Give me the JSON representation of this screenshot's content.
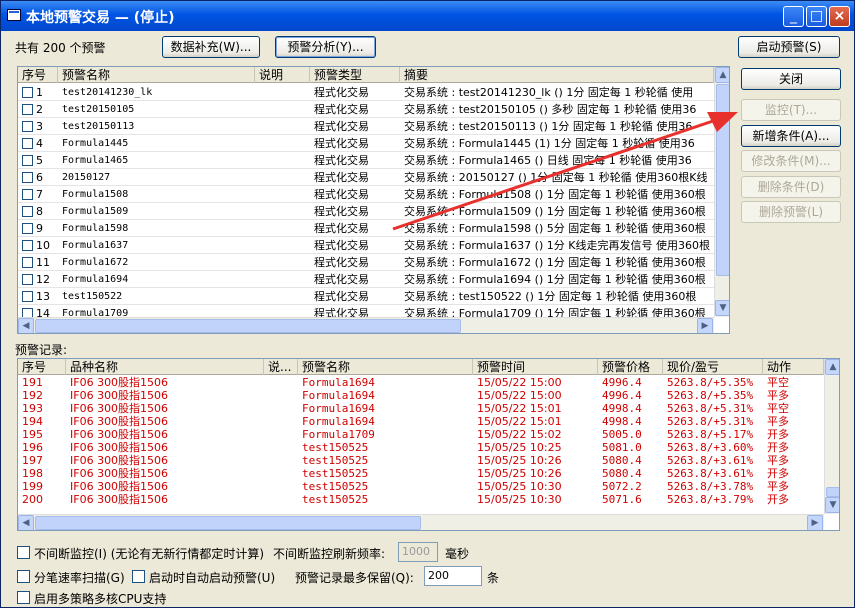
{
  "window": {
    "title": "本地预警交易 — (停止)"
  },
  "top": {
    "total_label": "共有 200 个预警",
    "btn_supplement": "数据补充(W)...",
    "btn_analysis": "预警分析(Y)...",
    "btn_start": "启动预警(S)"
  },
  "side": {
    "close": "关闭",
    "monitor": "监控(T)...",
    "add_cond": "新增条件(A)...",
    "edit_cond": "修改条件(M)...",
    "del_cond": "删除条件(D)",
    "del_alert": "删除预警(L)"
  },
  "alerts": {
    "headers": [
      "序号",
      "预警名称",
      "说明",
      "预警类型",
      "摘要"
    ],
    "rows": [
      [
        "1",
        "test20141230_lk",
        "",
        "程式化交易",
        "交易系统 : test20141230_lk () 1分 固定每 1 秒轮循 使用"
      ],
      [
        "2",
        "test20150105",
        "",
        "程式化交易",
        "交易系统 : test20150105 () 多秒 固定每 1 秒轮循 使用36"
      ],
      [
        "3",
        "test20150113",
        "",
        "程式化交易",
        "交易系统 : test20150113 () 1分 固定每 1 秒轮循 使用36"
      ],
      [
        "4",
        "Formula1445",
        "",
        "程式化交易",
        "交易系统 : Formula1445 (1) 1分 固定每 1 秒轮循 使用36"
      ],
      [
        "5",
        "Formula1465",
        "",
        "程式化交易",
        "交易系统 : Formula1465 () 日线 固定每 1 秒轮循 使用36"
      ],
      [
        "6",
        "20150127",
        "",
        "程式化交易",
        "交易系统 : 20150127 () 1分 固定每 1 秒轮循 使用360根K线"
      ],
      [
        "7",
        "Formula1508",
        "",
        "程式化交易",
        "交易系统 : Formula1508 () 1分 固定每 1 秒轮循 使用360根"
      ],
      [
        "8",
        "Formula1509",
        "",
        "程式化交易",
        "交易系统 : Formula1509 () 1分 固定每 1 秒轮循 使用360根"
      ],
      [
        "9",
        "Formula1598",
        "",
        "程式化交易",
        "交易系统 : Formula1598 () 5分 固定每 1 秒轮循 使用360根"
      ],
      [
        "10",
        "Formula1637",
        "",
        "程式化交易",
        "交易系统 : Formula1637 () 1分 K线走完再发信号 使用360根"
      ],
      [
        "11",
        "Formula1672",
        "",
        "程式化交易",
        "交易系统 : Formula1672 () 1分 固定每 1 秒轮循 使用360根"
      ],
      [
        "12",
        "Formula1694",
        "",
        "程式化交易",
        "交易系统 : Formula1694 () 1分 固定每 1 秒轮循 使用360根"
      ],
      [
        "13",
        "test150522",
        "",
        "程式化交易",
        "交易系统 : test150522 () 1分 固定每 1 秒轮循 使用360根"
      ],
      [
        "14",
        "Formula1709",
        "",
        "程式化交易",
        "交易系统 : Formula1709 () 1分 固定每 1 秒轮循 使用360根"
      ]
    ]
  },
  "records": {
    "section_label": "预警记录:",
    "headers": [
      "序号",
      "品种名称",
      "说...",
      "预警名称",
      "预警时间",
      "预警价格",
      "现价/盈亏",
      "动作"
    ],
    "rows": [
      [
        "191",
        "IF06 300股指1506",
        "",
        "Formula1694",
        "15/05/22 15:00",
        "4996.4",
        "5263.8/+5.35%",
        "平空"
      ],
      [
        "192",
        "IF06 300股指1506",
        "",
        "Formula1694",
        "15/05/22 15:00",
        "4996.4",
        "5263.8/+5.35%",
        "平多"
      ],
      [
        "193",
        "IF06 300股指1506",
        "",
        "Formula1694",
        "15/05/22 15:01",
        "4998.4",
        "5263.8/+5.31%",
        "平空"
      ],
      [
        "194",
        "IF06 300股指1506",
        "",
        "Formula1694",
        "15/05/22 15:01",
        "4998.4",
        "5263.8/+5.31%",
        "平多"
      ],
      [
        "195",
        "IF06 300股指1506",
        "",
        "Formula1709",
        "15/05/22 15:02",
        "5005.0",
        "5263.8/+5.17%",
        "开多"
      ],
      [
        "196",
        "IF06 300股指1506",
        "",
        "test150525",
        "15/05/25 10:25",
        "5081.0",
        "5263.8/+3.60%",
        "开多"
      ],
      [
        "197",
        "IF06 300股指1506",
        "",
        "test150525",
        "15/05/25 10:26",
        "5080.4",
        "5263.8/+3.61%",
        "平多"
      ],
      [
        "198",
        "IF06 300股指1506",
        "",
        "test150525",
        "15/05/25 10:26",
        "5080.4",
        "5263.8/+3.61%",
        "开多"
      ],
      [
        "199",
        "IF06 300股指1506",
        "",
        "test150525",
        "15/05/25 10:30",
        "5072.2",
        "5263.8/+3.78%",
        "平多"
      ],
      [
        "200",
        "IF06 300股指1506",
        "",
        "test150525",
        "15/05/25 10:30",
        "5071.6",
        "5263.8/+3.79%",
        "开多"
      ]
    ]
  },
  "options": {
    "continuous_monitor": "不间断监控(I) (无论有无新行情都定时计算)",
    "refresh_label": "不间断监控刷新频率:",
    "refresh_value": "1000",
    "refresh_unit": "毫秒",
    "tick_scan": "分笔速率扫描(G)",
    "auto_start": "启动时自动启动预警(U)",
    "max_keep_label": "预警记录最多保留(Q):",
    "max_keep_value": "200",
    "max_keep_unit": "条",
    "multicore": "启用多策略多核CPU支持"
  },
  "colors": {
    "record_text": "#d00000",
    "arrow": "#e8302c",
    "title_bar": "#0054e3"
  }
}
